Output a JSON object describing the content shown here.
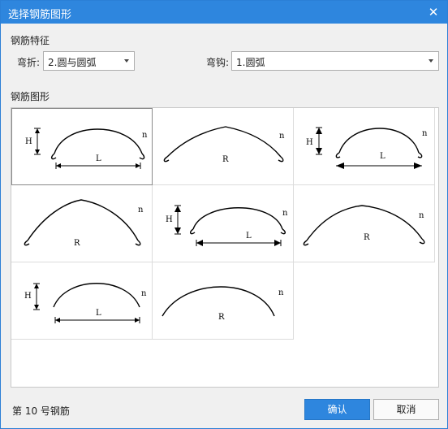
{
  "window": {
    "title": "选择钢筋图形",
    "close_glyph": "✕"
  },
  "features": {
    "section_label": "钢筋特征",
    "bend_label": "弯折:",
    "bend_value": "2.圆与圆弧",
    "hook_label": "弯钩:",
    "hook_value": "1.圆弧"
  },
  "shapes": {
    "section_label": "钢筋图形",
    "selected_index": 0,
    "items": [
      {
        "id": 1,
        "height_label": "H",
        "length_label": "L",
        "count_label": "n"
      },
      {
        "id": 2,
        "radius_label": "R",
        "count_label": "n"
      },
      {
        "id": 3,
        "height_label": "H",
        "length_label": "L",
        "count_label": "n"
      },
      {
        "id": 4,
        "radius_label": "R",
        "count_label": "n"
      },
      {
        "id": 5,
        "height_label": "H",
        "length_label": "L",
        "count_label": "n"
      },
      {
        "id": 6,
        "radius_label": "R",
        "count_label": "n"
      },
      {
        "id": 7,
        "height_label": "H",
        "length_label": "L",
        "count_label": "n"
      },
      {
        "id": 8,
        "radius_label": "R",
        "count_label": "n"
      }
    ]
  },
  "footer": {
    "status_text": "第 10 号钢筋",
    "ok_label": "确认",
    "cancel_label": "取消"
  },
  "colors": {
    "accent": "#2e86de",
    "title_text": "#ffffff"
  }
}
